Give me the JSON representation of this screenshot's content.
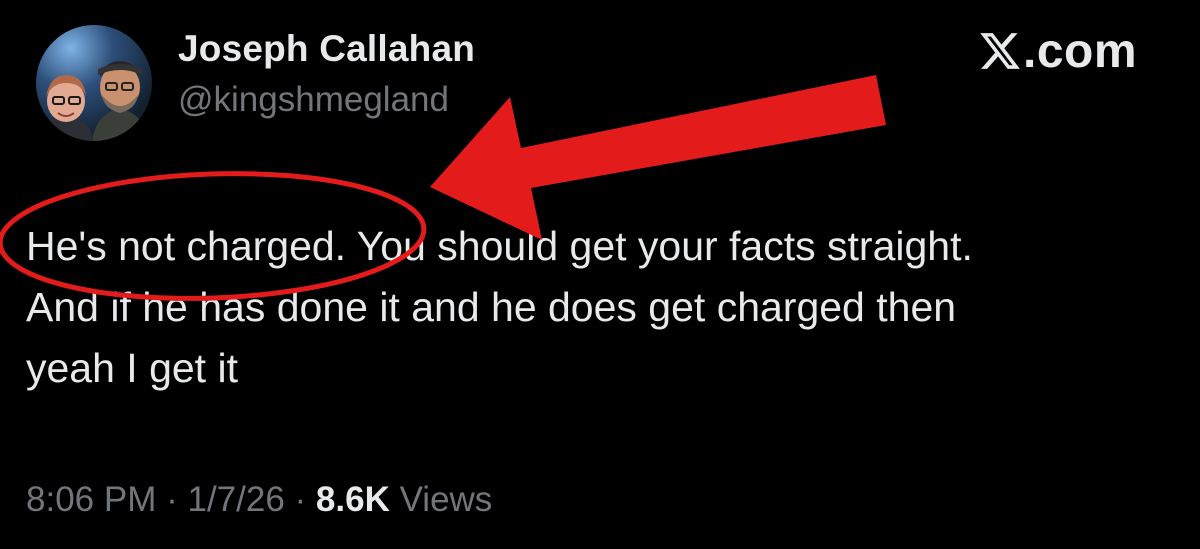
{
  "author": {
    "name": "Joseph Callahan",
    "handle": "@kingshmegland",
    "avatar_icon": "avatar-photo"
  },
  "site": {
    "logo_icon": "x-logo-icon",
    "domain": ".com"
  },
  "tweet": {
    "lines": [
      "He's not charged. You should get your facts straight.",
      "And if he has done it and he does get charged then",
      "yeah I get it"
    ]
  },
  "meta": {
    "time": "8:06 PM",
    "separator": "·",
    "date": "1/7/26",
    "views_count": "8.6K",
    "views_label": "Views"
  },
  "annotation": {
    "color": "#e41b1b",
    "shapes": [
      "red-circle",
      "red-arrow"
    ]
  },
  "colors": {
    "background": "#000000",
    "primary_text": "#e7e9ea",
    "secondary_text": "#71767b"
  }
}
